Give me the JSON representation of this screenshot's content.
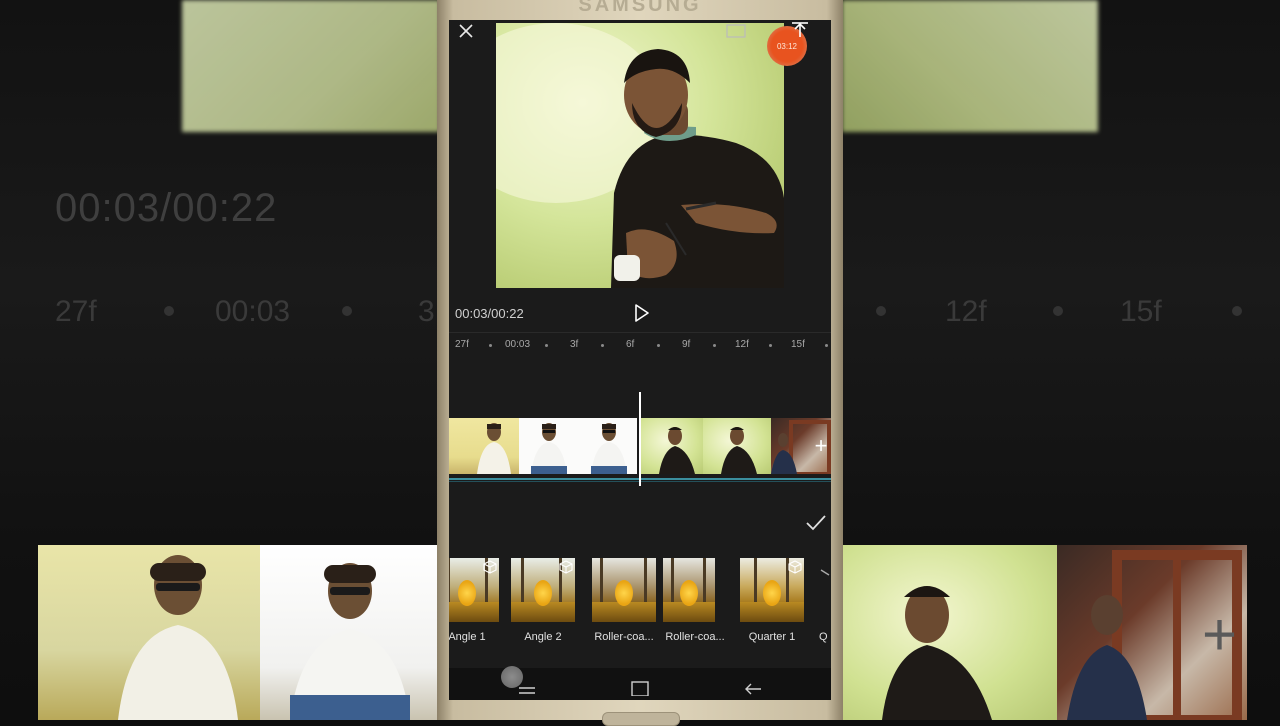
{
  "app": {
    "device_brand": "SAMSUNG",
    "rec_timer": "03:12",
    "time_display": "00:03/00:22",
    "ruler_labels": [
      "27f",
      "00:03",
      "3f",
      "6f",
      "9f",
      "12f",
      "15f"
    ],
    "transitions": [
      {
        "label": "Angle 1"
      },
      {
        "label": "Angle 2"
      },
      {
        "label": "Roller-coa..."
      },
      {
        "label": "Roller-coa..."
      },
      {
        "label": "Quarter 1"
      },
      {
        "label": "Q"
      }
    ]
  },
  "background": {
    "time_display": "00:03/00:22",
    "ruler_labels": [
      "27f",
      "00:03",
      "3",
      "12f",
      "15f"
    ]
  },
  "colors": {
    "accent": "#3b8f9e",
    "record": "#e8531f"
  }
}
